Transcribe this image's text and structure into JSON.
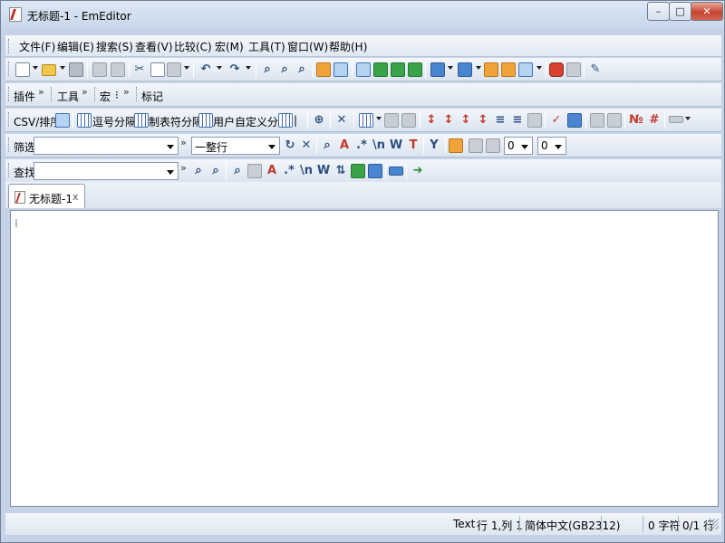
{
  "window": {
    "title": "无标题-1 - EmEditor",
    "min": "–",
    "max": "□",
    "close": "✕"
  },
  "menu": {
    "items": [
      "文件(F)",
      "编辑(E)",
      "搜索(S)",
      "查看(V)",
      "比较(C)",
      "宏(M)",
      "工具(T)",
      "窗口(W)",
      "帮助(H)"
    ]
  },
  "toolbar3": {
    "plugins": "插件",
    "tools": "工具",
    "macros": "宏",
    "bookmarks": "标记",
    "chev": "»",
    "colon": "⁝"
  },
  "csv": {
    "label": "CSV/排序",
    "comma": "逗号分隔",
    "tab": "制表符分隔",
    "user": "用户自定义分隔",
    "bar": "|"
  },
  "filter": {
    "label": "筛选",
    "mode": "一整行",
    "num1": "0",
    "num2": "0",
    "chev": "»"
  },
  "find": {
    "label": "查找",
    "chev": "»"
  },
  "doc_tab": {
    "label": "无标题-1",
    "close": "x"
  },
  "editor": {
    "caret": "⁞"
  },
  "statusbar": {
    "mode": "Text",
    "position": "行 1,列 1",
    "encoding": "简体中文(GB2312)",
    "chars": "0 字符",
    "lines": "0/1 行"
  },
  "colors": {
    "accent": "#3d74b8",
    "chrome": "#c6d3e6",
    "close": "#c7442f"
  }
}
